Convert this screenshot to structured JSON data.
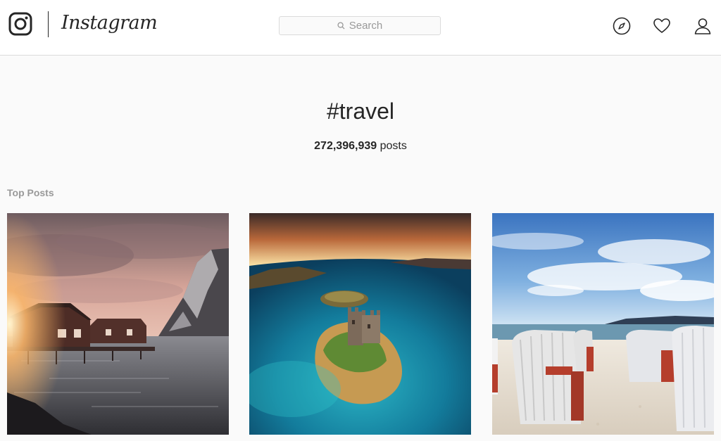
{
  "header": {
    "wordmark": "Instagram",
    "search_placeholder": "Search",
    "icons": [
      "instagram-glyph-icon",
      "search-icon",
      "compass-icon",
      "heart-icon",
      "profile-icon"
    ]
  },
  "hashtag": {
    "title": "#travel",
    "post_count": "272,396,939",
    "post_label": "posts"
  },
  "sections": {
    "top_posts_label": "Top Posts"
  },
  "posts": [
    {
      "subject": "red cabins on stilts by a fjord at sunset"
    },
    {
      "subject": "aerial view of a castle on a small island"
    },
    {
      "subject": "white hooded beach chairs on a sandy beach"
    }
  ],
  "colors": {
    "text": "#262626",
    "muted": "#999999",
    "border": "#dbdbdb",
    "background": "#fafafa"
  }
}
